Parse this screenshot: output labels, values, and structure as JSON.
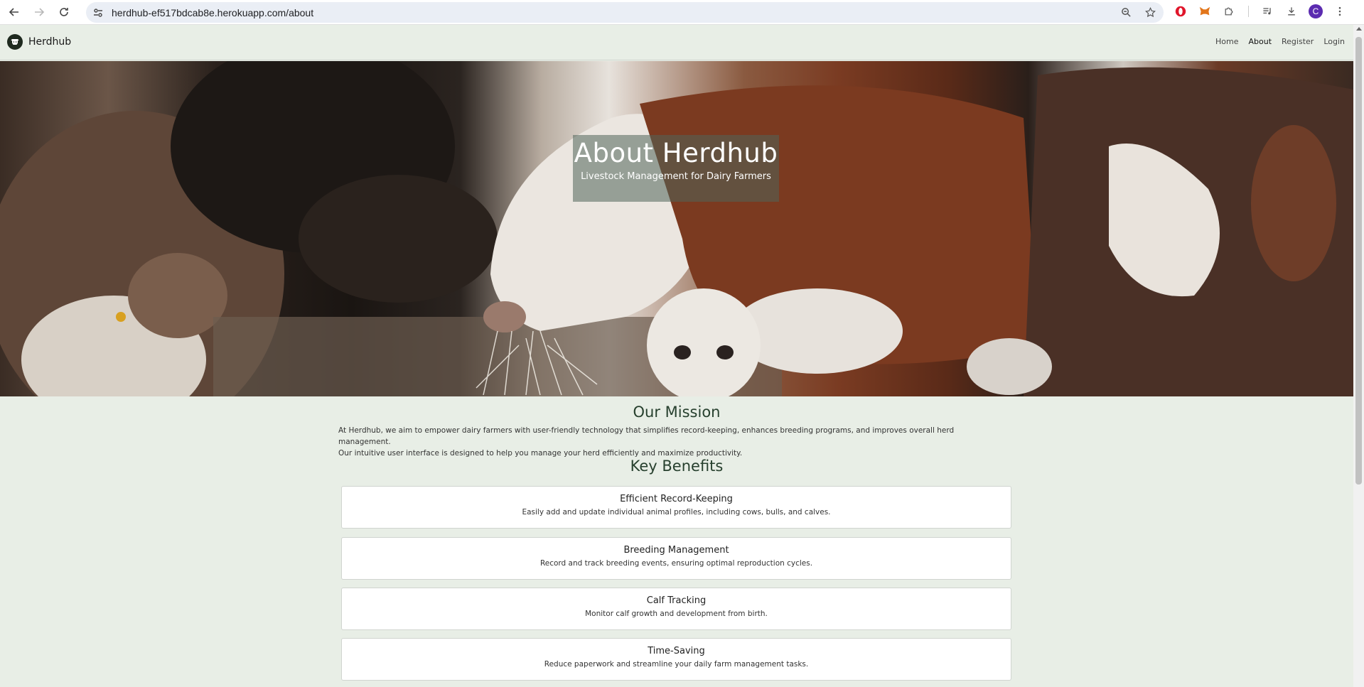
{
  "browser": {
    "url": "herdhub-ef517bdcab8e.herokuapp.com/about",
    "profile_initial": "C"
  },
  "navbar": {
    "brand": "Herdhub",
    "links": [
      "Home",
      "About",
      "Register",
      "Login"
    ],
    "active": "About"
  },
  "hero": {
    "title": "About Herdhub",
    "subtitle": "Livestock Management for Dairy Farmers"
  },
  "mission": {
    "heading": "Our Mission",
    "line1": "At Herdhub, we aim to empower dairy farmers with user-friendly technology that simplifies record-keeping, enhances breeding programs, and improves overall herd management.",
    "line2": "Our intuitive user interface is designed to help you manage your herd efficiently and maximize productivity."
  },
  "benefits": {
    "heading": "Key Benefits",
    "items": [
      {
        "title": "Efficient Record-Keeping",
        "desc": "Easily add and update individual animal profiles, including cows, bulls, and calves."
      },
      {
        "title": "Breeding Management",
        "desc": "Record and track breeding events, ensuring optimal reproduction cycles."
      },
      {
        "title": "Calf Tracking",
        "desc": "Monitor calf growth and development from birth."
      },
      {
        "title": "Time-Saving",
        "desc": "Reduce paperwork and streamline your daily farm management tasks."
      }
    ]
  },
  "colors": {
    "page_bg": "#e8eee6",
    "heading": "#27402e",
    "hero_overlay": "rgba(80,100,90,0.55)"
  }
}
